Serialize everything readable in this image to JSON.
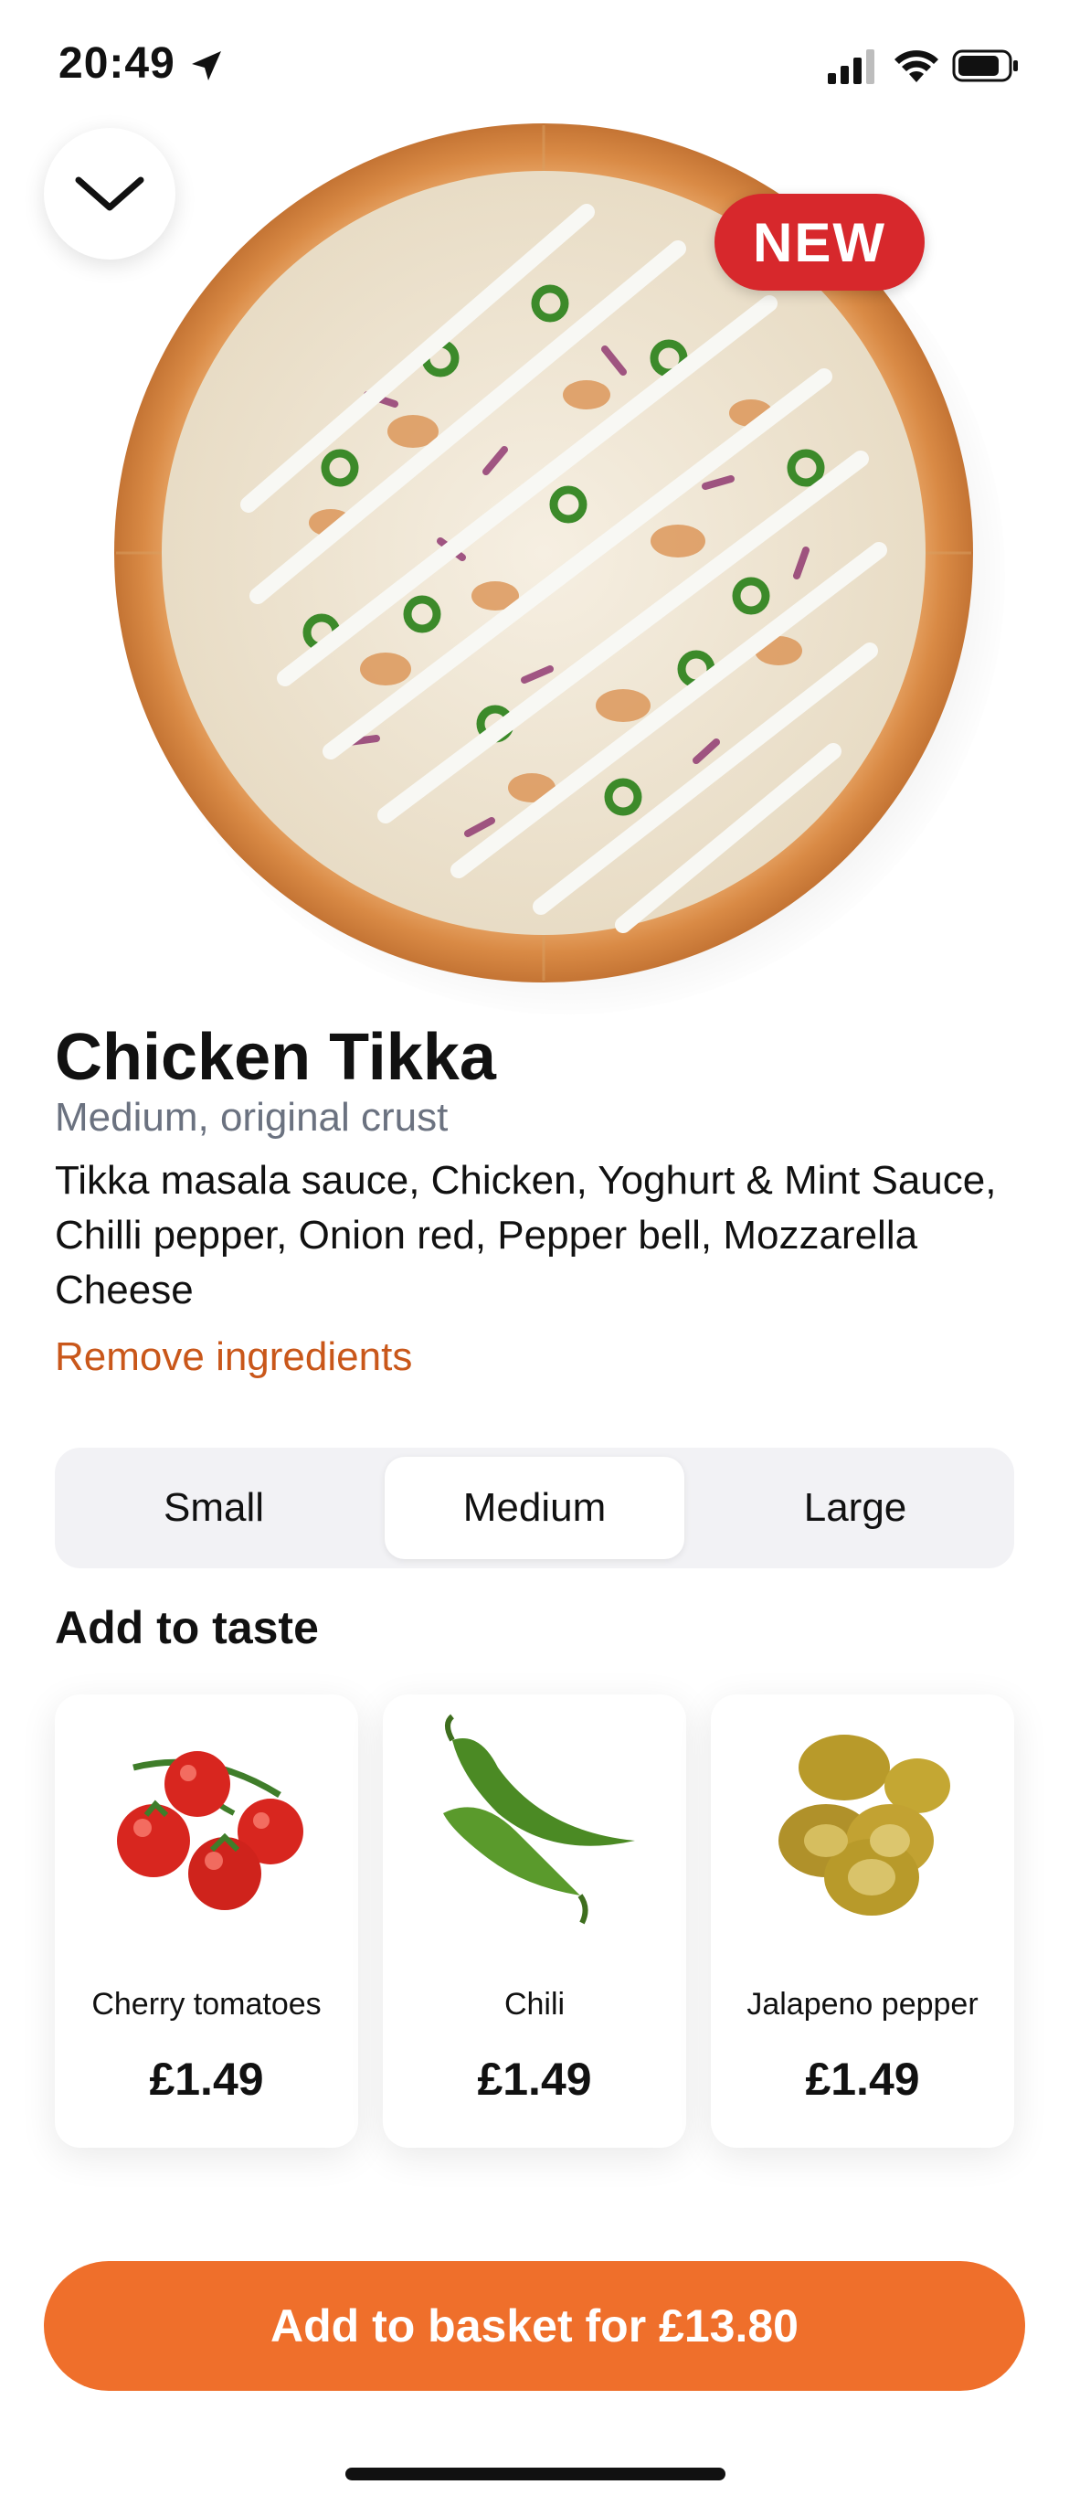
{
  "status": {
    "time": "20:49"
  },
  "badge": {
    "label": "NEW"
  },
  "product": {
    "name": "Chicken Tikka",
    "variant": "Medium, original crust",
    "ingredients": "Tikka masala sauce, Chicken, Yoghurt & Mint Sauce, Chilli pepper, Onion red, Pepper bell, Mozzarella Cheese",
    "remove_label": "Remove ingredients"
  },
  "sizes": {
    "options": [
      "Small",
      "Medium",
      "Large"
    ],
    "selected": "Medium"
  },
  "toppings": {
    "title": "Add to taste",
    "items": [
      {
        "name": "Cherry tomatoes",
        "price": "£1.49",
        "icon": "cherry-tomatoes-icon"
      },
      {
        "name": "Chili",
        "price": "£1.49",
        "icon": "chili-icon"
      },
      {
        "name": "Jalapeno pepper",
        "price": "£1.49",
        "icon": "jalapeno-icon"
      }
    ]
  },
  "cta": {
    "label": "Add to basket for £13.80"
  },
  "colors": {
    "accent": "#ef6f2b",
    "link": "#c9571a",
    "badge": "#d7282c",
    "muted": "#6b7280",
    "segment_bg": "#f2f2f5"
  }
}
